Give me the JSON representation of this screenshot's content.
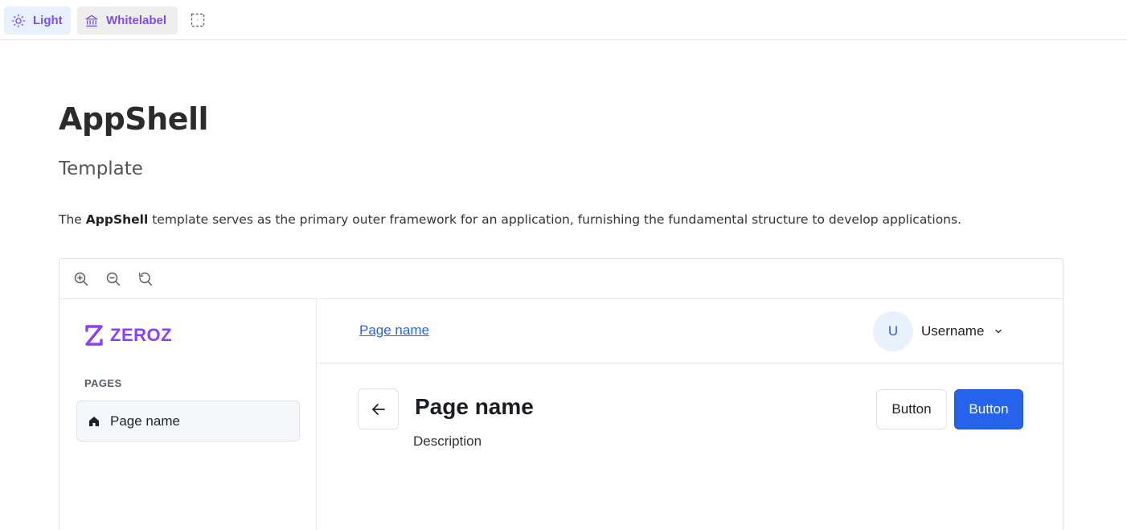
{
  "toolbar": {
    "theme_label": "Light",
    "theme_icon": "sun-icon",
    "brand_label": "Whitelabel",
    "brand_icon": "bank-icon",
    "outline_icon": "dashed-square-icon",
    "accent": "#7c4fe0"
  },
  "header": {
    "title": "AppShell",
    "subtitle": "Template",
    "description_prefix": "The ",
    "description_bold": "AppShell",
    "description_suffix": " template serves as the primary outer framework for an application, furnishing the fundamental structure to develop applications."
  },
  "preview": {
    "zoom_icons": [
      "zoom-in-icon",
      "zoom-out-icon",
      "zoom-reset-icon"
    ],
    "sidebar": {
      "logo_text": "ZEROZ",
      "section_label": "PAGES",
      "items": [
        {
          "label": "Page name",
          "icon": "home-icon",
          "active": true
        }
      ]
    },
    "topbar": {
      "breadcrumb": "Page name",
      "avatar_initial": "U",
      "username": "Username"
    },
    "page": {
      "title": "Page name",
      "description": "Description",
      "secondary_button": "Button",
      "primary_button": "Button"
    },
    "colors": {
      "primary": "#2563eb",
      "logo": "#8a3ffc"
    }
  }
}
